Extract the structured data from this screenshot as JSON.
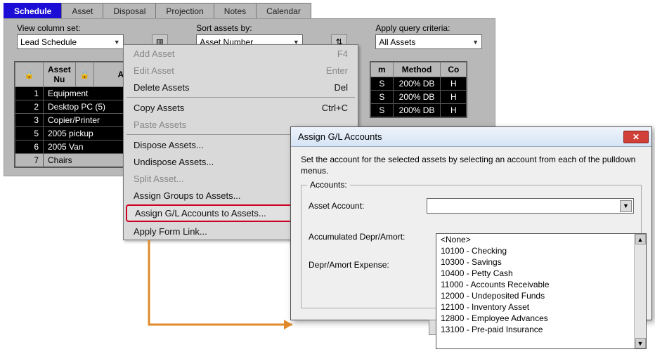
{
  "tabs": [
    "Schedule",
    "Asset",
    "Disposal",
    "Projection",
    "Notes",
    "Calendar"
  ],
  "controls": {
    "colset_label": "View column set:",
    "colset_value": "Lead Schedule",
    "sort_label": "Sort assets by:",
    "sort_value": "Asset  Number",
    "query_label": "Apply query criteria:",
    "query_value": "All Assets"
  },
  "gridHeaders": {
    "assetnum": "Asset\nNu",
    "asset": "Asset",
    "m": "m",
    "method": "Method",
    "co": "Co"
  },
  "rows": [
    {
      "n": "1",
      "desc": "Equipment",
      "m": "S",
      "method": "200% DB",
      "c": "H"
    },
    {
      "n": "2",
      "desc": "Desktop PC (5)",
      "m": "S",
      "method": "200% DB",
      "c": "H"
    },
    {
      "n": "3",
      "desc": "Copier/Printer",
      "m": "S",
      "method": "200% DB",
      "c": "H"
    },
    {
      "n": "5",
      "desc": "2005 pickup",
      "m": "",
      "method": "",
      "c": ""
    },
    {
      "n": "6",
      "desc": "2005 Van",
      "m": "",
      "method": "",
      "c": ""
    },
    {
      "n": "7",
      "desc": "Chairs",
      "m": "",
      "method": "",
      "c": ""
    }
  ],
  "menu": {
    "add": {
      "label": "Add Asset",
      "key": "F4"
    },
    "edit": {
      "label": "Edit Asset",
      "key": "Enter"
    },
    "delete": {
      "label": "Delete Assets",
      "key": "Del"
    },
    "copy": {
      "label": "Copy Assets",
      "key": "Ctrl+C"
    },
    "paste": {
      "label": "Paste Assets",
      "key": ""
    },
    "dispose": {
      "label": "Dispose Assets...",
      "key": ""
    },
    "undispose": {
      "label": "Undispose Assets...",
      "key": ""
    },
    "split": {
      "label": "Split Asset...",
      "key": ""
    },
    "groups": {
      "label": "Assign Groups to Assets...",
      "key": ""
    },
    "gl": {
      "label": "Assign G/L Accounts to Assets...",
      "key": ""
    },
    "formlink": {
      "label": "Apply Form Link...",
      "key": ""
    }
  },
  "dialog": {
    "title": "Assign G/L Accounts",
    "intro": "Set the account for the selected assets by selecting an account from each of the pulldown menus.",
    "legend": "Accounts:",
    "f1": "Asset Account:",
    "f2": "Accumulated Depr/Amort:",
    "f3": "Depr/Amort Expense:"
  },
  "options": [
    "<None>",
    "10100 - Checking",
    "10300 - Savings",
    "10400 - Petty Cash",
    "11000 - Accounts Receivable",
    "12000 - Undeposited Funds",
    "12100 - Inventory Asset",
    "12800 - Employee Advances",
    "13100 - Pre-paid Insurance"
  ]
}
